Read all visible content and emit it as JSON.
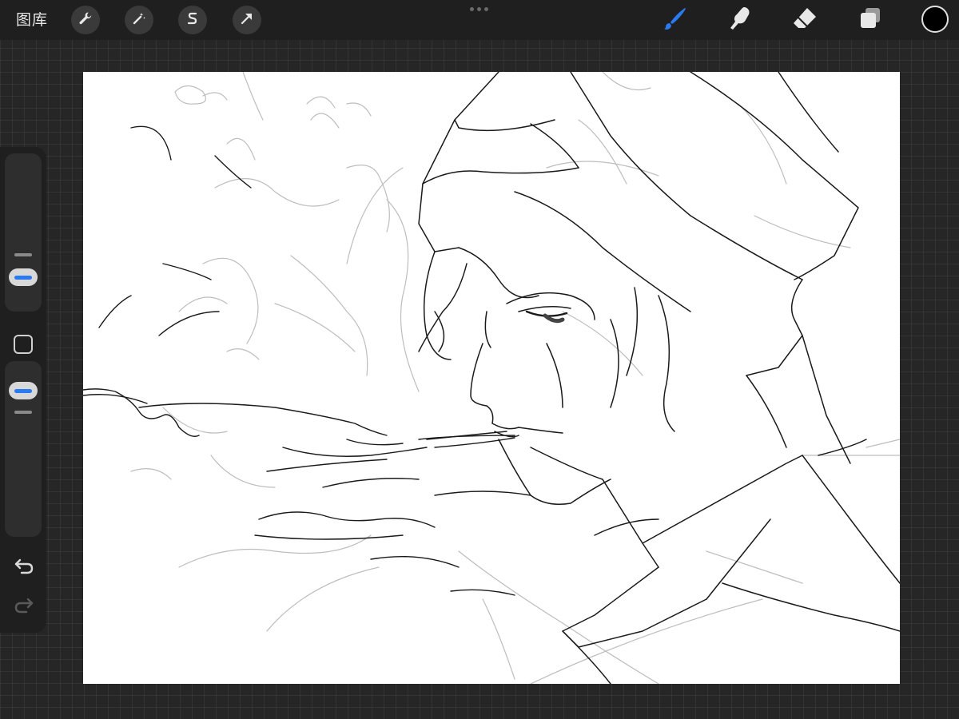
{
  "toolbar": {
    "gallery_label": "图库",
    "left_tools": [
      {
        "name": "actions",
        "icon": "wrench-icon"
      },
      {
        "name": "adjustments",
        "icon": "magic-wand-icon"
      },
      {
        "name": "selection",
        "icon": "selection-s-icon"
      },
      {
        "name": "transform",
        "icon": "arrow-cursor-icon"
      }
    ],
    "right_tools": [
      {
        "name": "brush",
        "icon": "brush-icon",
        "active": true
      },
      {
        "name": "smudge",
        "icon": "smudge-icon",
        "active": false
      },
      {
        "name": "eraser",
        "icon": "eraser-icon",
        "active": false
      },
      {
        "name": "layers",
        "icon": "layers-icon",
        "active": false
      }
    ],
    "current_color": "#000000",
    "accent_color": "#2a7bf2"
  },
  "sidebar": {
    "brush_size_level": 0.2,
    "brush_opacity_level": 0.9,
    "modify_button": "square-modify-icon",
    "undo_icon": "undo-arrow-icon",
    "redo_icon": "redo-arrow-icon"
  },
  "canvas": {
    "content": "line-art sketch",
    "background_color": "#ffffff"
  }
}
